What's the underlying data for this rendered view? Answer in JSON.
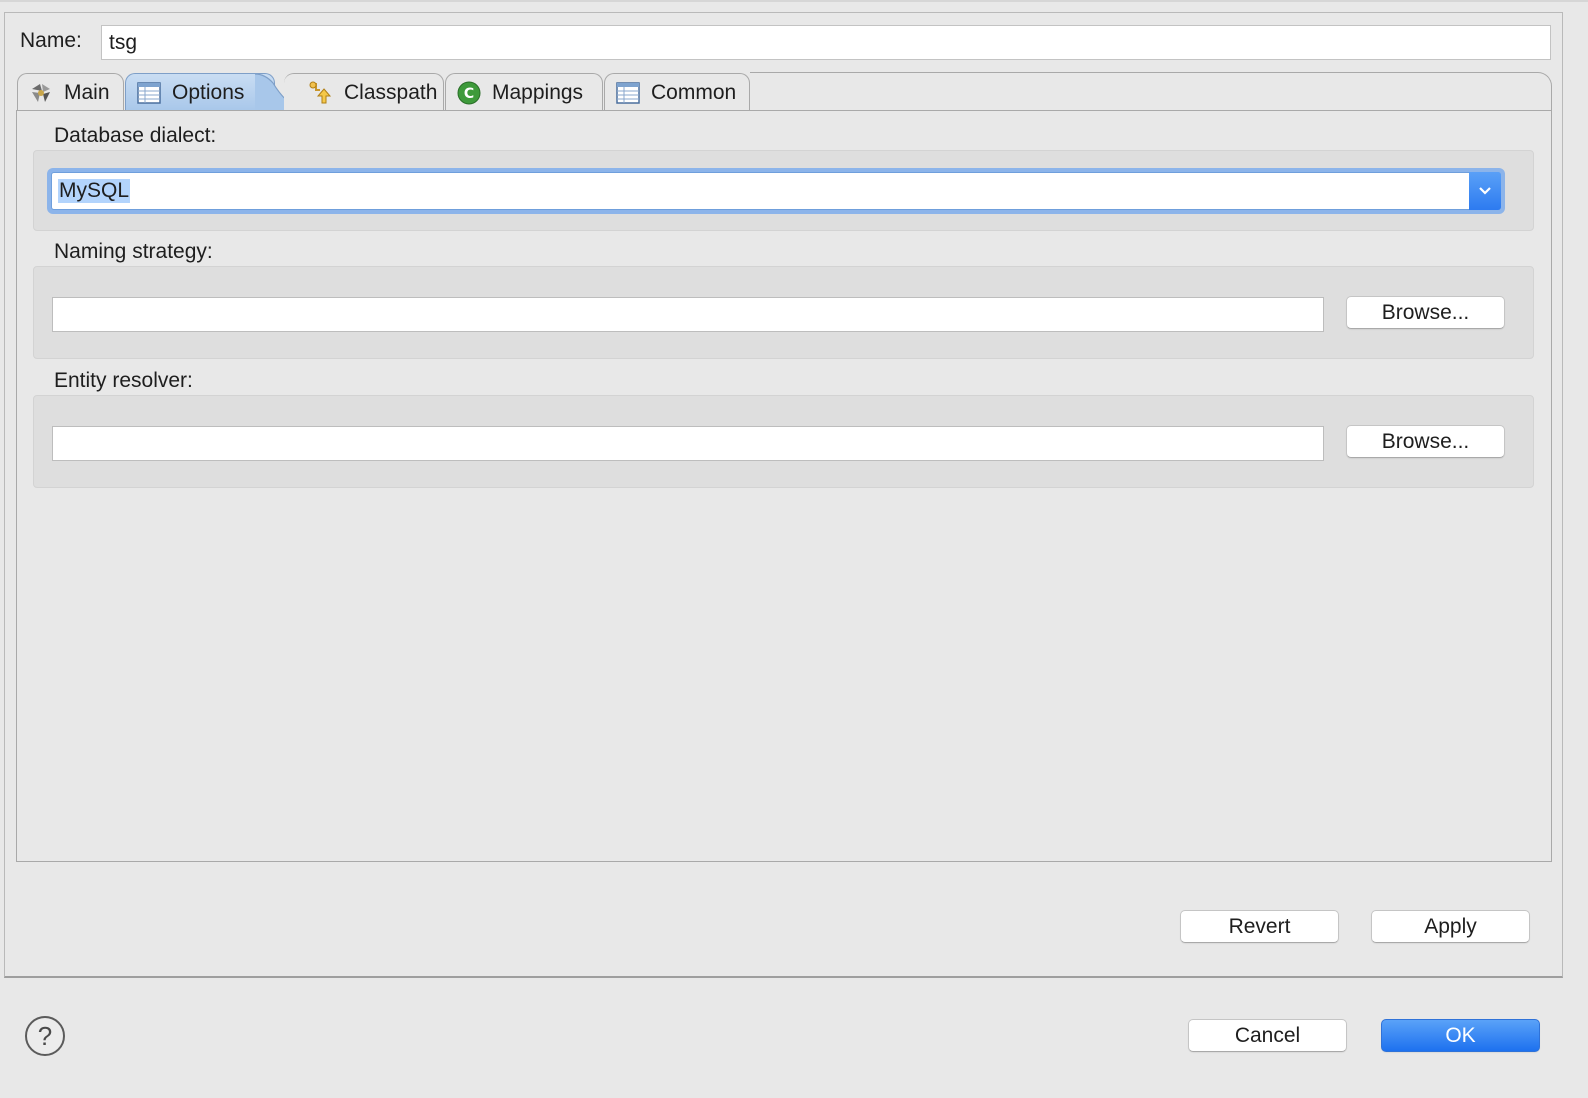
{
  "name_field": {
    "label": "Name:",
    "value": "tsg"
  },
  "tabs": [
    {
      "label": "Main",
      "icon": "hibernate-icon"
    },
    {
      "label": "Options",
      "icon": "table-icon",
      "active": true
    },
    {
      "label": "Classpath",
      "icon": "classpath-icon"
    },
    {
      "label": "Mappings",
      "icon": "mappings-c-icon"
    },
    {
      "label": "Common",
      "icon": "table-icon"
    }
  ],
  "options": {
    "dialect": {
      "label": "Database dialect:",
      "value": "MySQL"
    },
    "naming": {
      "label": "Naming strategy:",
      "value": "",
      "browse_label": "Browse..."
    },
    "entity": {
      "label": "Entity resolver:",
      "value": "",
      "browse_label": "Browse..."
    }
  },
  "panel_buttons": {
    "revert": "Revert",
    "apply": "Apply"
  },
  "dialog_buttons": {
    "cancel": "Cancel",
    "ok": "OK",
    "help": "?"
  },
  "colors": {
    "accent": "#1d71ef",
    "selection": "#b3d4fc",
    "tab_active": "#a8c7ea"
  }
}
